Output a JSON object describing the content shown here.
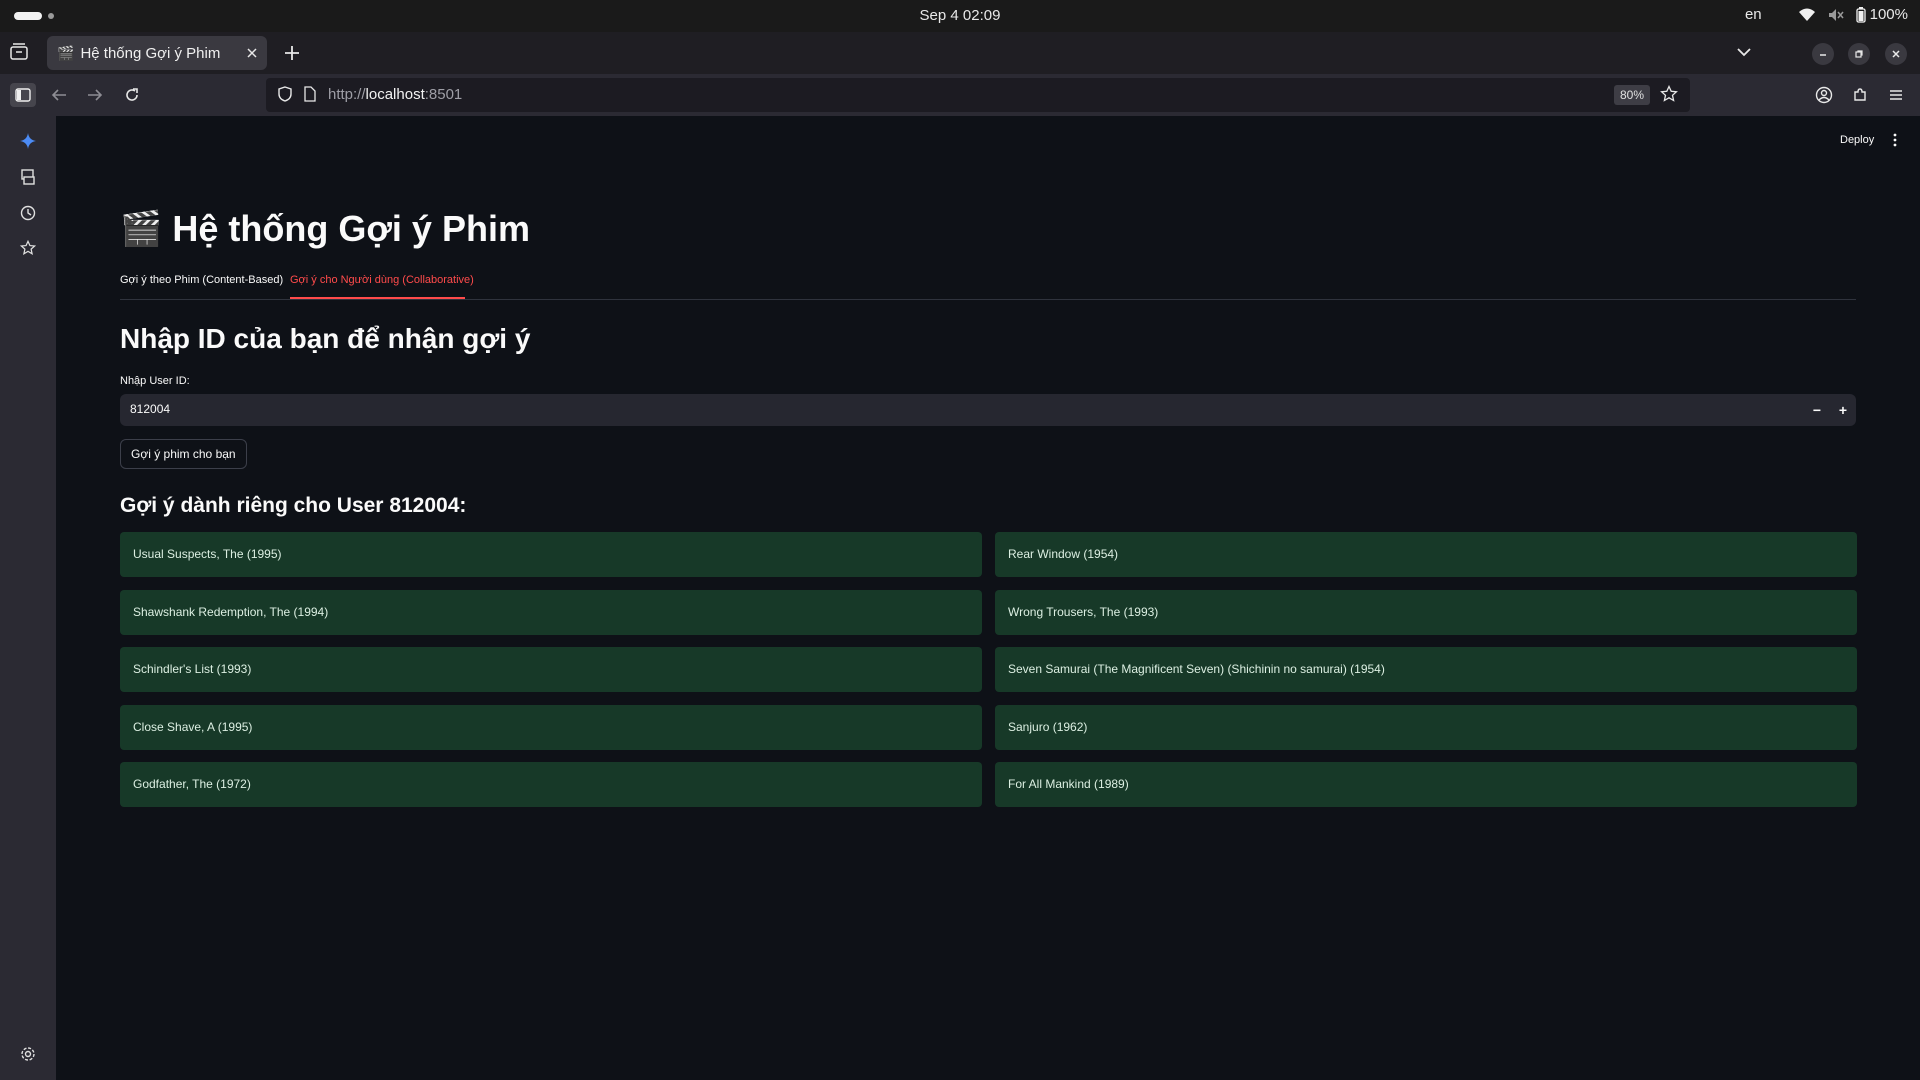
{
  "os": {
    "clock": "Sep 4  02:09",
    "language": "en",
    "battery": "100%"
  },
  "browser": {
    "tab_title": "Hệ thống Gợi ý Phim",
    "url_scheme": "http://",
    "url_host": "localhost",
    "url_port": ":8501",
    "zoom": "80%"
  },
  "app": {
    "deploy_label": "Deploy",
    "title": "Hệ thống Gợi ý Phim",
    "tabs": [
      {
        "label": "Gợi ý theo Phim (Content-Based)"
      },
      {
        "label": "Gợi ý cho Người dùng (Collaborative)"
      }
    ],
    "section_heading": "Nhập ID của bạn để nhận gợi ý",
    "input_label": "Nhập User ID:",
    "input_value": "812004",
    "stepper_minus": "−",
    "stepper_plus": "+",
    "button_label": "Gợi ý phim cho bạn",
    "results_heading": "Gợi ý dành riêng cho User 812004:",
    "recommendations_left": [
      "Usual Suspects, The (1995)",
      "Shawshank Redemption, The (1994)",
      "Schindler's List (1993)",
      "Close Shave, A (1995)",
      "Godfather, The (1972)"
    ],
    "recommendations_right": [
      "Rear Window (1954)",
      "Wrong Trousers, The (1993)",
      "Seven Samurai (The Magnificent Seven) (Shichinin no samurai) (1954)",
      "Sanjuro (1962)",
      "For All Mankind (1989)"
    ]
  },
  "colors": {
    "accent": "#ff4b4b",
    "app_bg": "#0e1117",
    "card_bg": "#173928",
    "input_bg": "#262730"
  }
}
